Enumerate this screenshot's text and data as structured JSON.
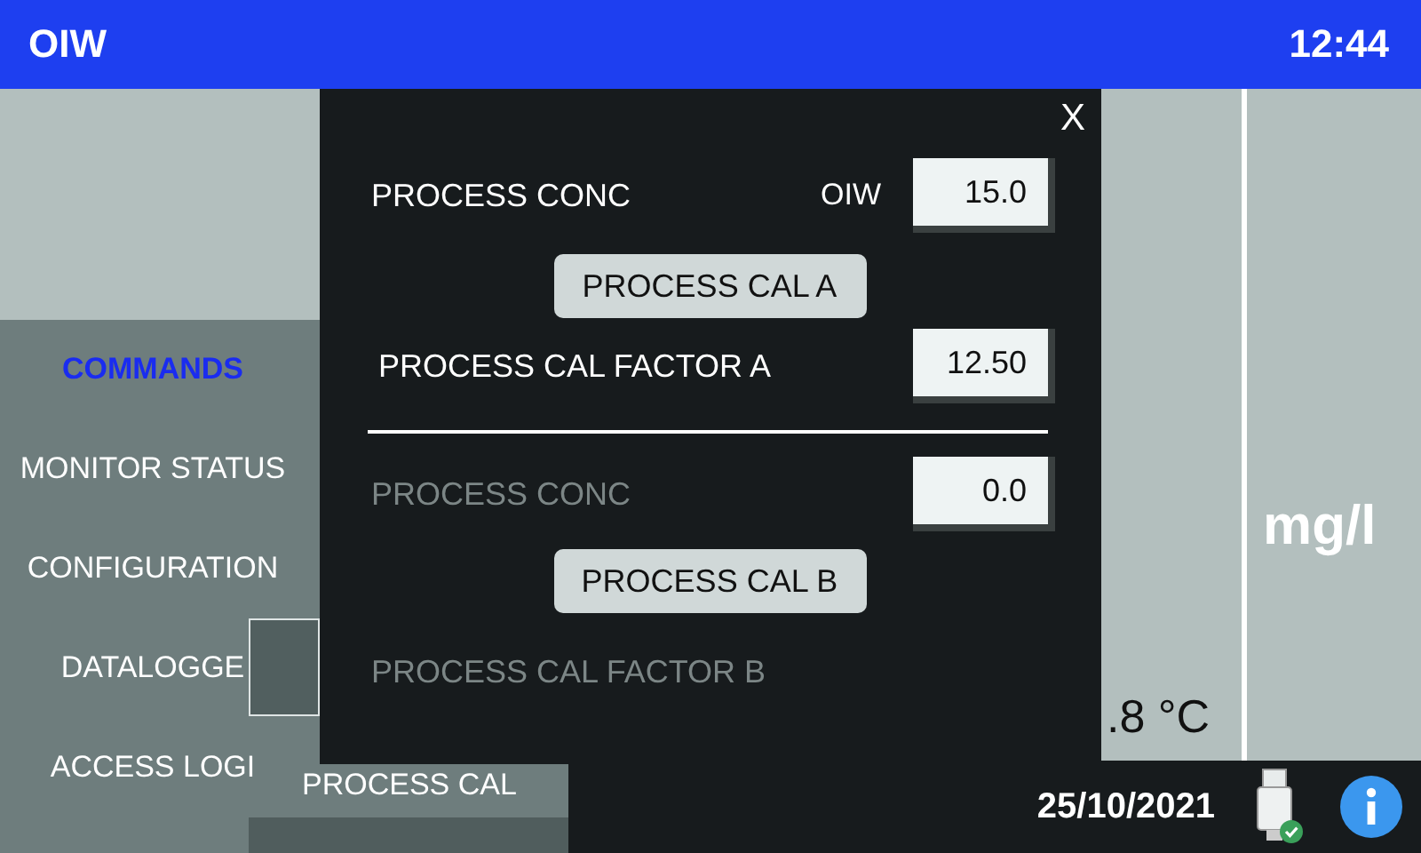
{
  "header": {
    "title": "OIW",
    "time": "12:44"
  },
  "reading": {
    "unit": "mg/l",
    "temperature": ".8 °C"
  },
  "menu": {
    "items": [
      {
        "label": "COMMANDS",
        "selected": true
      },
      {
        "label": "MONITOR STATUS",
        "selected": false
      },
      {
        "label": "CONFIGURATION",
        "selected": false
      },
      {
        "label": "DATALOGGE",
        "selected": false
      },
      {
        "label": "ACCESS LOGI",
        "selected": false
      }
    ]
  },
  "submenu": {
    "label": "PROCESS CAL"
  },
  "dialog": {
    "close": "X",
    "sections": [
      {
        "disabled": false,
        "conc_label": "PROCESS CONC",
        "conc_unit": "OIW",
        "conc_value": "15.0",
        "button": "PROCESS CAL A",
        "factor_label": "PROCESS CAL FACTOR A",
        "factor_value": "12.50"
      },
      {
        "disabled": true,
        "conc_label": "PROCESS CONC",
        "conc_value": "0.0",
        "button": "PROCESS CAL B",
        "factor_label": "PROCESS CAL FACTOR B"
      }
    ]
  },
  "status_bar": {
    "date": "25/10/2021"
  }
}
